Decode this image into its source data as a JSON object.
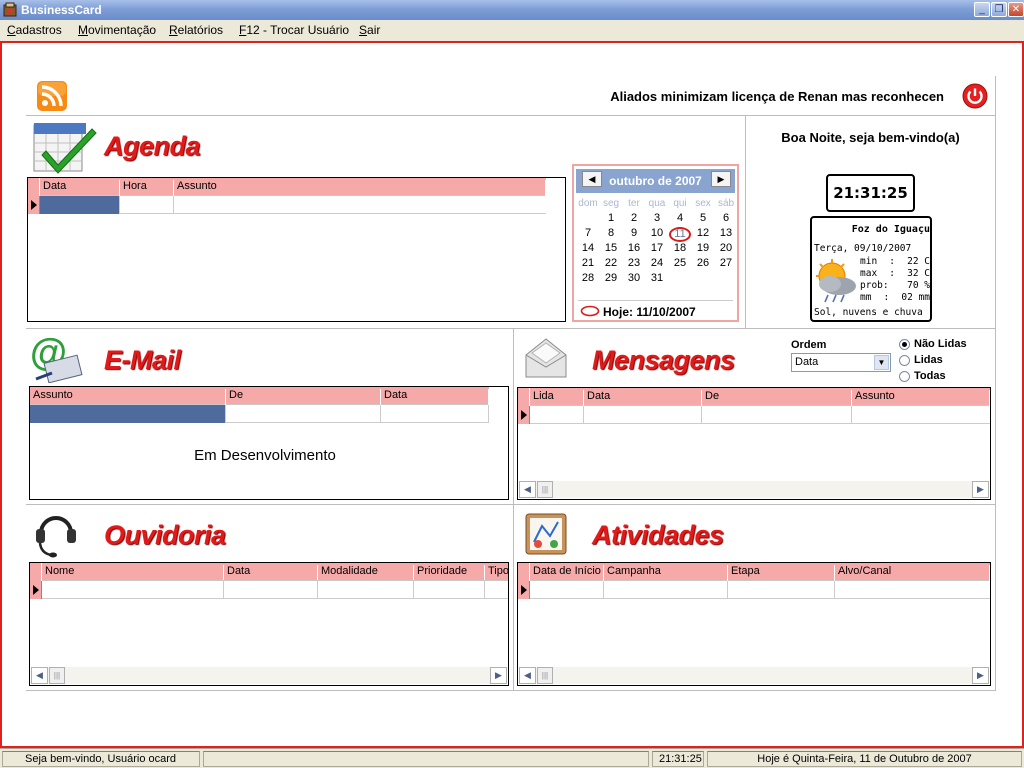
{
  "window": {
    "title": "BusinessCard"
  },
  "menu": [
    {
      "accel": "C",
      "rest": "adastros"
    },
    {
      "accel": "M",
      "rest": "ovimentação"
    },
    {
      "accel": "R",
      "rest": "elatórios"
    },
    {
      "accel": "F",
      "rest": "12 - Trocar Usuário"
    },
    {
      "accel": "S",
      "rest": "air"
    }
  ],
  "ticker": "Aliados minimizam licença de Renan mas reconhecen",
  "agenda": {
    "title": "Agenda",
    "columns": [
      "Data",
      "Hora",
      "Assunto"
    ]
  },
  "calendar": {
    "month_label": "outubro de 2007",
    "prev": "◀",
    "next": "▶",
    "weekdays": [
      "dom",
      "seg",
      "ter",
      "qua",
      "qui",
      "sex",
      "sáb"
    ],
    "weeks": [
      [
        "",
        "1",
        "2",
        "3",
        "4",
        "5",
        "6"
      ],
      [
        "7",
        "8",
        "9",
        "10",
        "11",
        "12",
        "13"
      ],
      [
        "14",
        "15",
        "16",
        "17",
        "18",
        "19",
        "20"
      ],
      [
        "21",
        "22",
        "23",
        "24",
        "25",
        "26",
        "27"
      ],
      [
        "28",
        "29",
        "30",
        "31",
        "",
        "",
        ""
      ]
    ],
    "today_day": "11",
    "today_label": "Hoje: 11/10/2007"
  },
  "welcome": {
    "greeting": "Boa Noite, seja bem-vindo(a)",
    "clock": "21:31:25"
  },
  "weather": {
    "city": "Foz do Iguaçu",
    "date": "Terça, 09/10/2007",
    "lines": [
      {
        "k": "min",
        "v": "22 C"
      },
      {
        "k": "max",
        "v": "32 C"
      },
      {
        "k": "prob:",
        "v": "70 %"
      },
      {
        "k": "mm",
        "v": "02 mm"
      }
    ],
    "summary": "Sol, nuvens e chuva"
  },
  "email": {
    "title": "E-Mail",
    "columns": [
      "Assunto",
      "De",
      "Data"
    ],
    "notice": "Em Desenvolvimento"
  },
  "messages": {
    "title": "Mensagens",
    "order_label": "Ordem",
    "order_value": "Data",
    "filters": [
      "Não Lidas",
      "Lidas",
      "Todas"
    ],
    "columns": [
      "Lida",
      "Data",
      "De",
      "Assunto"
    ]
  },
  "ouvidoria": {
    "title": "Ouvidoria",
    "columns": [
      "Nome",
      "Data",
      "Modalidade",
      "Prioridade",
      "Tipo"
    ]
  },
  "atividades": {
    "title": "Atividades",
    "columns": [
      "Data de Início",
      "Campanha",
      "Etapa",
      "Alvo/Canal"
    ]
  },
  "status": {
    "user": "Seja bem-vindo, Usuário ocard",
    "time": "21:31:25",
    "date": "Hoje é Quinta-Feira, 11 de Outubro de 2007"
  },
  "colors": {
    "accent": "#e11919",
    "grid_header": "#f6a9a9",
    "calendar_header": "#8aa4d0"
  }
}
